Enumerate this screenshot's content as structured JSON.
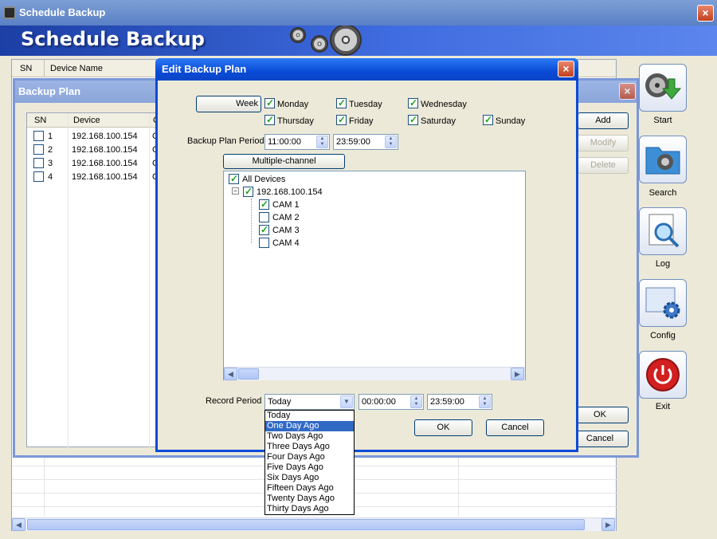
{
  "main_window": {
    "title": "Schedule Backup",
    "banner_title": "Schedule Backup",
    "close_label": "×"
  },
  "bg_list": {
    "columns": [
      "SN",
      "Device Name"
    ]
  },
  "toolbar": [
    {
      "label": "Start",
      "icon": "start-download-icon"
    },
    {
      "label": "Search",
      "icon": "search-film-icon"
    },
    {
      "label": "Log",
      "icon": "log-magnifier-icon"
    },
    {
      "label": "Config",
      "icon": "config-gear-icon"
    },
    {
      "label": "Exit",
      "icon": "power-icon"
    }
  ],
  "backup_plan": {
    "title": "Backup Plan",
    "columns": [
      "SN",
      "Device",
      "C"
    ],
    "rows": [
      {
        "sn": "1",
        "device": "192.168.100.154",
        "c": "C"
      },
      {
        "sn": "2",
        "device": "192.168.100.154",
        "c": "C"
      },
      {
        "sn": "3",
        "device": "192.168.100.154",
        "c": "C"
      },
      {
        "sn": "4",
        "device": "192.168.100.154",
        "c": "C"
      }
    ],
    "buttons": {
      "add": "Add",
      "modify": "Modify",
      "delete": "Delete",
      "ok": "OK",
      "cancel": "Cancel"
    }
  },
  "edit_dialog": {
    "title": "Edit Backup Plan",
    "week_button": "Week",
    "days": [
      {
        "label": "Monday",
        "checked": true
      },
      {
        "label": "Tuesday",
        "checked": true
      },
      {
        "label": "Wednesday",
        "checked": true
      },
      {
        "label": "Thursday",
        "checked": true
      },
      {
        "label": "Friday",
        "checked": true
      },
      {
        "label": "Saturday",
        "checked": true
      },
      {
        "label": "Sunday",
        "checked": true
      }
    ],
    "period_label": "Backup Plan Period",
    "period_start": "11:00:00",
    "period_end": "23:59:00",
    "multichannel_button": "Multiple-channel",
    "tree": {
      "all_devices": "All Devices",
      "device": "192.168.100.154",
      "cams": [
        {
          "label": "CAM 1",
          "checked": true
        },
        {
          "label": "CAM 2",
          "checked": false
        },
        {
          "label": "CAM 3",
          "checked": true
        },
        {
          "label": "CAM 4",
          "checked": false
        }
      ]
    },
    "record_period_label": "Record Period",
    "record_period_value": "Today",
    "record_start": "00:00:00",
    "record_end": "23:59:00",
    "ok": "OK",
    "cancel": "Cancel",
    "dropdown_options": [
      "Today",
      "One Day Ago",
      "Two Days Ago",
      "Three Days Ago",
      "Four Days Ago",
      "Five Days Ago",
      "Six Days Ago",
      "Fifteen Days Ago",
      "Twenty Days Ago",
      "Thirty Days Ago"
    ],
    "dropdown_selected": "One Day Ago"
  },
  "colors": {
    "xp_blue": "#0a4bd6",
    "banner": "#3f6ce0",
    "check_green": "#21a121",
    "selection": "#316ac5"
  }
}
